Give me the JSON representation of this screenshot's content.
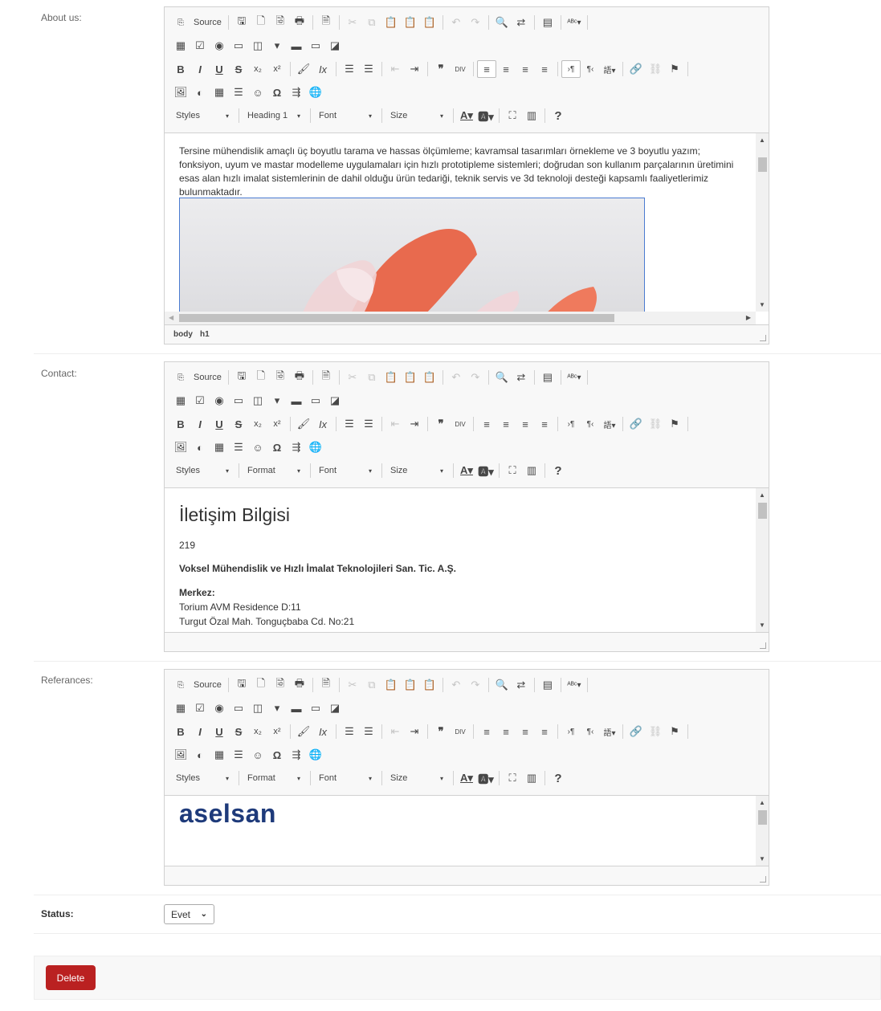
{
  "toolbar": {
    "source_label": "Source",
    "styles_label": "Styles",
    "format_label": "Format",
    "font_label": "Font",
    "size_label": "Size",
    "help_glyph": "?"
  },
  "about": {
    "label": "About us:",
    "format_value": "Heading 1",
    "paragraph": "Tersine mühendislik amaçlı üç boyutlu tarama ve hassas ölçümleme; kavramsal tasarımları örnekleme ve 3 boyutlu yazım; fonksiyon, uyum ve mastar modelleme uygulamaları için hızlı prototipleme sistemleri; doğrudan son kullanım parçalarının üretimini esas alan hızlı imalat sistemlerinin de dahil olduğu ürün tedariği, teknik servis ve 3d teknoloji desteği kapsamlı faaliyetlerimiz bulunmaktadır.",
    "path_body": "body",
    "path_h1": "h1"
  },
  "contact": {
    "label": "Contact:",
    "heading": "İletişim Bilgisi",
    "number": "219",
    "company": "Voksel Mühendislik ve Hızlı İmalat Teknolojileri San. Tic. A.Ş.",
    "office_label": "Merkez:",
    "address_line1": "Torium AVM Residence D:11",
    "address_line2": "Turgut Özal Mah. Tonguçbaba Cd. No:21"
  },
  "references": {
    "label": "Referances:",
    "logo_text": "aselsan",
    "logo_color": "#1e3a7a"
  },
  "status": {
    "label": "Status:",
    "value": "Evet"
  },
  "actions": {
    "delete_label": "Delete",
    "delete_color": "#ba2121"
  }
}
